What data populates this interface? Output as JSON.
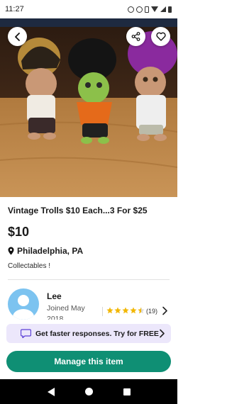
{
  "status_bar": {
    "time": "11:27",
    "icons": [
      "alarm-icon",
      "n-icon",
      "vibrate-icon",
      "wifi-icon",
      "signal-icon",
      "battery-icon"
    ]
  },
  "hero": {
    "image": "photo of three troll dolls with orange, green and purple hair on a wooden table",
    "buttons": [
      "back-icon",
      "share-icon",
      "heart-icon"
    ]
  },
  "listing": {
    "title": "Vintage Trolls $10 Each...3 For $25",
    "price": "$10",
    "location": "Philadelphia, PA",
    "category": "Collectables !"
  },
  "seller": {
    "name": "Lee",
    "joined": "Joined May",
    "joined_year": "2018",
    "rating_stars": 4.5,
    "review_count": "(19)"
  },
  "promo": {
    "text": "Get faster responses. Try for FREE"
  },
  "actions": {
    "manage_label": "Manage this item"
  },
  "colors": {
    "primary": "#0f8f74",
    "promo_bg": "#ece7fb",
    "promo_icon": "#5b3fd6",
    "star": "#f2b705",
    "avatar_bg": "#7cc3f0"
  }
}
